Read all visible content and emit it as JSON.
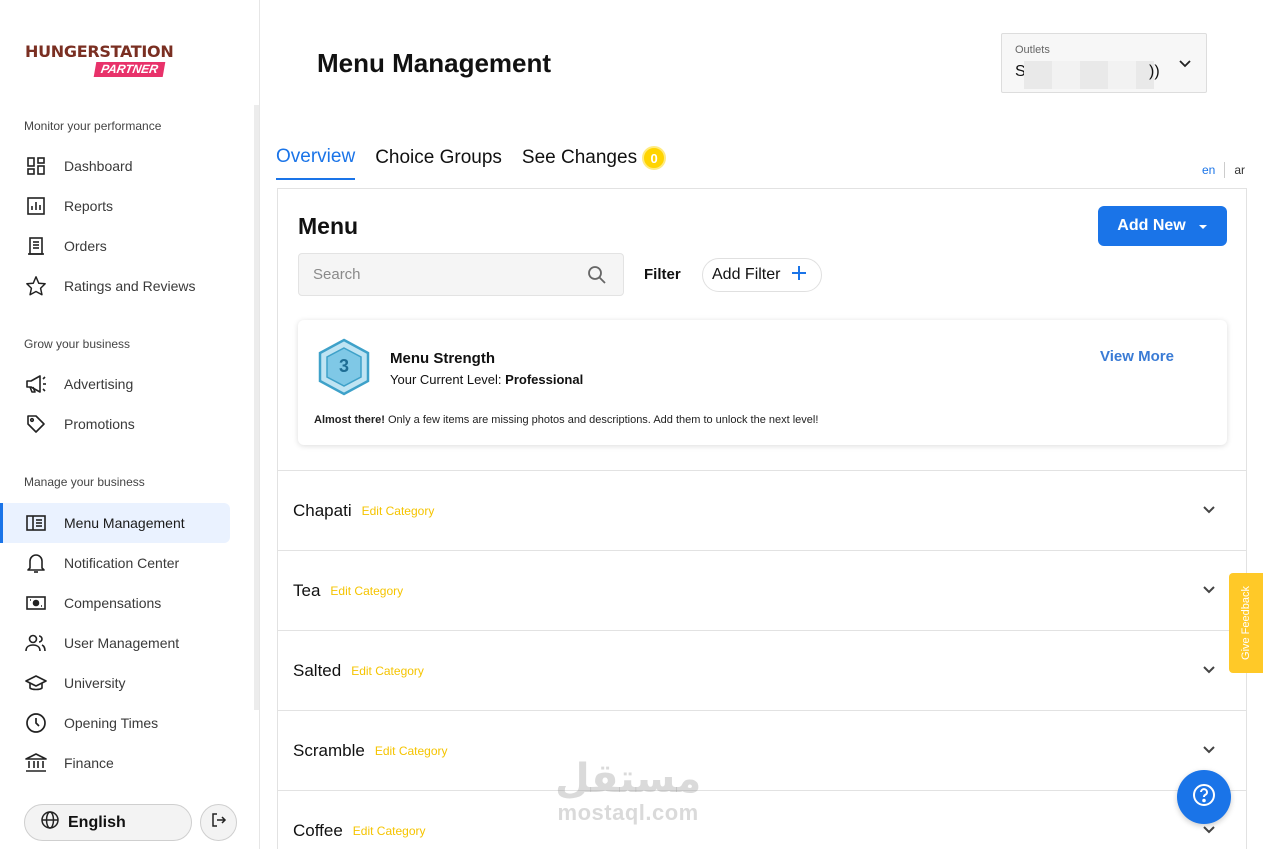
{
  "brand": {
    "line1": "HUNGERSTATION",
    "line2": "PARTNER",
    "color_primary": "#7a2f22",
    "color_accent": "#e8326a"
  },
  "sidebar": {
    "sections": [
      {
        "title": "Monitor your performance"
      },
      {
        "title": "Grow your business"
      },
      {
        "title": "Manage your business"
      }
    ],
    "items": [
      {
        "label": "Dashboard",
        "icon": "dashboard-icon"
      },
      {
        "label": "Reports",
        "icon": "reports-icon"
      },
      {
        "label": "Orders",
        "icon": "orders-icon"
      },
      {
        "label": "Ratings and Reviews",
        "icon": "star-icon"
      },
      {
        "label": "Advertising",
        "icon": "megaphone-icon"
      },
      {
        "label": "Promotions",
        "icon": "tag-icon"
      },
      {
        "label": "Menu Management",
        "icon": "menu-book-icon",
        "active": true
      },
      {
        "label": "Notification Center",
        "icon": "bell-icon"
      },
      {
        "label": "Compensations",
        "icon": "cash-icon"
      },
      {
        "label": "User Management",
        "icon": "users-icon"
      },
      {
        "label": "University",
        "icon": "graduation-cap-icon"
      },
      {
        "label": "Opening Times",
        "icon": "clock-icon"
      },
      {
        "label": "Finance",
        "icon": "bank-icon"
      }
    ],
    "language": "English"
  },
  "header": {
    "title": "Menu Management",
    "outlet": {
      "caption": "Outlets",
      "value_start": "S",
      "value_end": "))"
    }
  },
  "tabs": [
    {
      "label": "Overview",
      "active": true
    },
    {
      "label": "Choice Groups"
    },
    {
      "label": "See Changes",
      "badge": "0"
    }
  ],
  "lang_switch": {
    "en": "en",
    "ar": "ar"
  },
  "menu": {
    "heading": "Menu",
    "add_new": "Add New",
    "search_placeholder": "Search",
    "filter_label": "Filter",
    "add_filter": "Add Filter"
  },
  "strength": {
    "level_number": "3",
    "title": "Menu Strength",
    "level_prefix": "Your Current Level:",
    "level_value": "Professional",
    "view_more": "View More",
    "note_bold": "Almost there!",
    "note_text": "Only a few items are missing photos and descriptions. Add them to unlock the next level!"
  },
  "categories": [
    {
      "name": "Chapati",
      "edit": "Edit Category"
    },
    {
      "name": "Tea",
      "edit": "Edit Category"
    },
    {
      "name": "Salted",
      "edit": "Edit Category"
    },
    {
      "name": "Scramble",
      "edit": "Edit Category"
    },
    {
      "name": "Coffee",
      "edit": "Edit Category"
    }
  ],
  "watermark": {
    "arabic": "مستقل",
    "latin": "mostaql.com"
  },
  "feedback": "Give Feedback",
  "colors": {
    "primary": "#1a74e8",
    "badge": "#ffd400",
    "edit": "#f5c400",
    "feedback": "#ffc928"
  }
}
